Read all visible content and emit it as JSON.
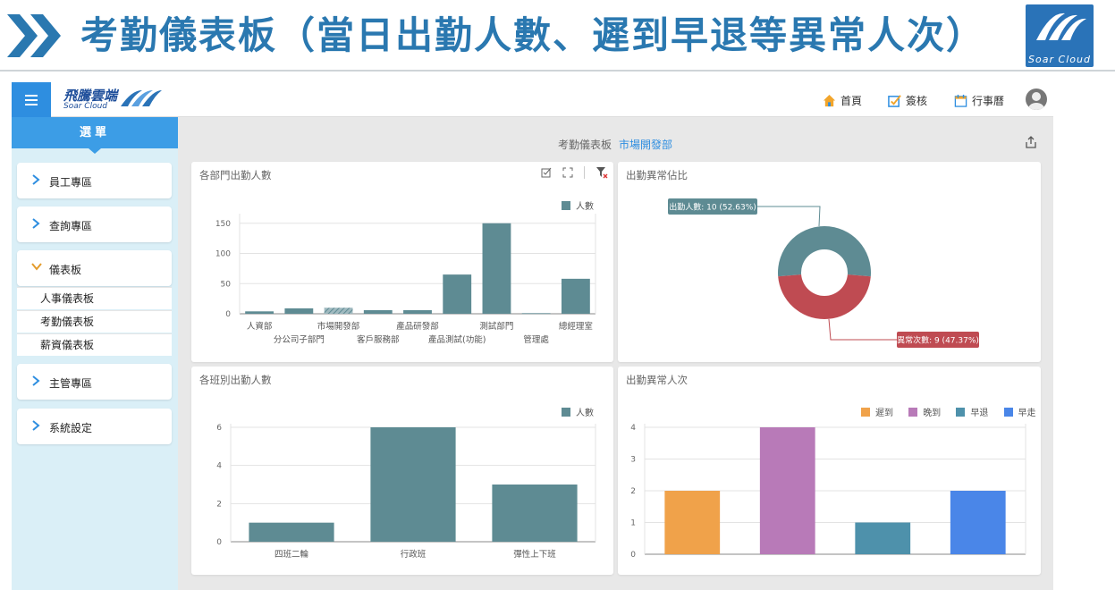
{
  "banner": {
    "title": "考勤儀表板（當日出勤人數、遲到早退等異常人次）",
    "logo_text": "Soar Cloud"
  },
  "topbar": {
    "brand_cn": "飛騰雲端",
    "brand_en": "Soar Cloud",
    "nav": [
      {
        "label": "首頁",
        "icon": "home-icon"
      },
      {
        "label": "簽核",
        "icon": "sign-check-icon"
      },
      {
        "label": "行事曆",
        "icon": "calendar-icon"
      }
    ]
  },
  "sidebar": {
    "header": "選單",
    "items": [
      {
        "label": "員工專區",
        "expanded": false
      },
      {
        "label": "查詢專區",
        "expanded": false
      },
      {
        "label": "儀表板",
        "expanded": true,
        "children": [
          "人事儀表板",
          "考勤儀表板",
          "薪資儀表板"
        ]
      },
      {
        "label": "主管專區",
        "expanded": false
      },
      {
        "label": "系統設定",
        "expanded": false
      }
    ]
  },
  "breadcrumb": {
    "page": "考勤儀表板",
    "link": "市場開發部"
  },
  "colors": {
    "accent": "#2e8ee0",
    "bar_teal": "#5e8b93",
    "donut_red": "#bf4b52",
    "late": "#f0a24a",
    "very_late": "#b87ab8",
    "leave_early": "#4e91ab",
    "early_go": "#4a86e8"
  },
  "panels": {
    "dept": {
      "title": "各部門出勤人數",
      "legend": "人數",
      "chart_data": {
        "type": "bar",
        "categories": [
          "人資部",
          "分公司子部門",
          "市場開發部",
          "客戶服務部",
          "產品研發部",
          "產品測試(功能)",
          "測試部門",
          "管理處",
          "總經理室"
        ],
        "values": [
          4,
          9,
          10,
          6,
          6,
          65,
          150,
          1,
          58
        ],
        "ylim": [
          0,
          160
        ],
        "yticks": [
          0,
          50,
          100,
          150
        ],
        "highlighted": "市場開發部"
      }
    },
    "ratio": {
      "title": "出勤異常佔比",
      "chart_data": {
        "type": "pie",
        "labels": [
          "出勤人數",
          "異常次數"
        ],
        "values": [
          10,
          9
        ],
        "label_text": [
          "出勤人數: 10 (52.63%)",
          "異常次數: 9 (47.37%)"
        ]
      }
    },
    "shift": {
      "title": "各班別出勤人數",
      "legend": "人數",
      "chart_data": {
        "type": "bar",
        "categories": [
          "四班二輪",
          "行政班",
          "彈性上下班"
        ],
        "values": [
          1,
          6,
          3
        ],
        "ylim": [
          0,
          6
        ],
        "yticks": [
          0,
          2,
          4,
          6
        ]
      }
    },
    "abnormal": {
      "title": "出勤異常人次",
      "legend": [
        "遲到",
        "晚到",
        "早退",
        "早走"
      ],
      "chart_data": {
        "type": "bar",
        "categories": [
          "遲到",
          "晚到",
          "早退",
          "早走"
        ],
        "values": [
          2,
          4,
          1,
          2
        ],
        "ylim": [
          0,
          4
        ],
        "yticks": [
          0,
          1,
          2,
          3,
          4
        ]
      }
    }
  }
}
